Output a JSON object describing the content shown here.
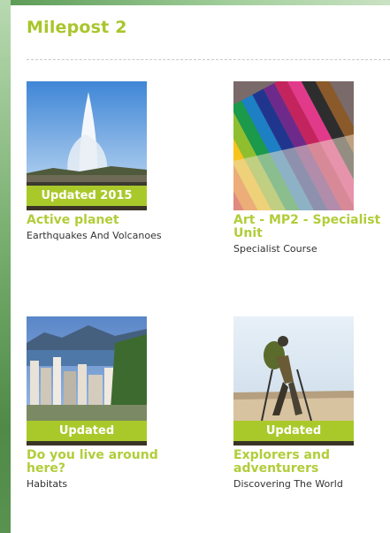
{
  "section": {
    "title": "Milepost 2"
  },
  "cards": [
    {
      "badge": "Updated 2015",
      "title": "Active planet",
      "subtitle": "Earthquakes And Volcanoes",
      "image": "geyser-photo"
    },
    {
      "badge": "",
      "title": "Art - MP2 - Specialist Unit",
      "subtitle": "Specialist Course",
      "image": "colored-pencils-photo"
    },
    {
      "badge": "Updated",
      "title": "Do you live around here?",
      "subtitle": "Habitats",
      "image": "city-photo"
    },
    {
      "badge": "Updated",
      "title": "Explorers and adventurers",
      "subtitle": "Discovering The World",
      "image": "hiker-photo"
    }
  ],
  "colors": {
    "accent": "#a9c92b",
    "title": "#b1cd3a",
    "frame": "#5a9a54"
  }
}
